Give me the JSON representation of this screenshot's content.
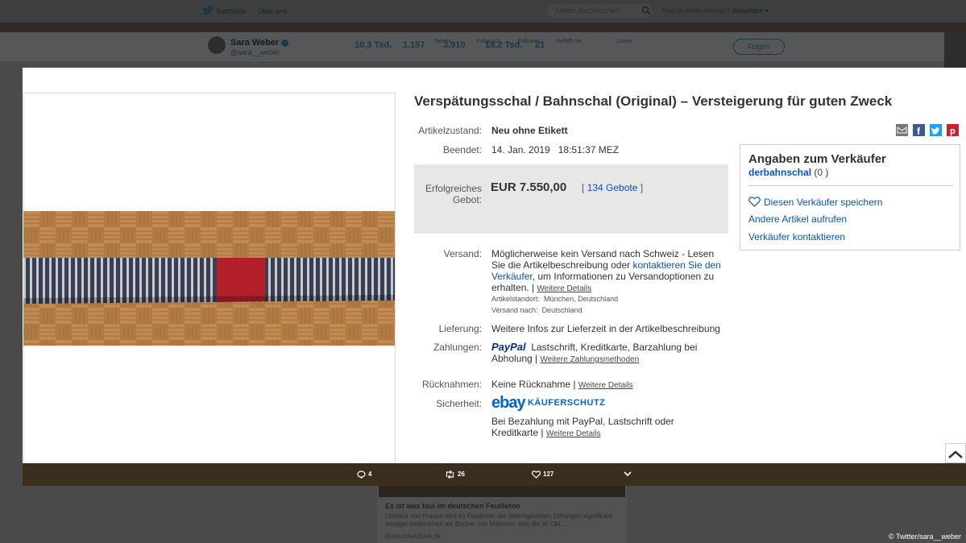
{
  "twitter": {
    "nav": {
      "home": "Startseite",
      "about": "Über uns",
      "search_placeholder": "Twitter durchsuchen",
      "account_prompt": "Hast du einen Account?",
      "login": "Anmelden"
    },
    "profile": {
      "name": "Sara Weber",
      "handle": "@sara__weber",
      "stats": [
        {
          "label": "Tweets",
          "value": "10,3 Tsd."
        },
        {
          "label": "Folge ich",
          "value": "1.157"
        },
        {
          "label": "Follower",
          "value": "3.910"
        },
        {
          "label": "Gefällt mir",
          "value": "18,2 Tsd."
        },
        {
          "label": "Listen",
          "value": "21"
        }
      ],
      "follow_button": "Folgen"
    },
    "actions": {
      "replies": "4",
      "retweets": "26",
      "likes": "127"
    },
    "card": {
      "title": "Es ist was faul im deutschen Feuilleton",
      "text": "Literatur von Frauen wird im Feuilleton der überregionalen Zeitungen signifikant weniger besprochen als Bücher von Männern. Wie die im Okt…",
      "source": "deutschlandfunk.de"
    }
  },
  "ebay": {
    "title": "Verspätungsschal / Bahnschal (Original) – Versteigerung für guten Zweck",
    "condition_label": "Artikelzustand:",
    "condition_value": "Neu ohne Etikett",
    "ended_label": "Beendet:",
    "ended_date": "14. Jan. 2019",
    "ended_time": "18:51:37 MEZ",
    "bid_label_1": "Erfolgreiches",
    "bid_label_2": "Gebot:",
    "bid_price": "EUR 7.550,00",
    "bid_count_prefix": "[",
    "bid_count": "134 Gebote",
    "bid_count_suffix": "]",
    "shipping_label": "Versand:",
    "shipping_line1": "Möglicherweise kein Versand nach Schweiz - Lesen",
    "shipping_line2a": "Sie die Artikelbeschreibung oder",
    "shipping_link_a": "kontaktieren Sie den",
    "shipping_link_b": "Verkäufer",
    "shipping_line3b": ", um Informationen zu Versandoptionen zu",
    "shipping_line4": "erhalten. |",
    "shipping_details": "Weitere Details",
    "location_label": "Artikelstandort:",
    "location_value": "München, Deutschland",
    "ship_to_label": "Versand nach:",
    "ship_to_value": "Deutschland",
    "delivery_label": "Lieferung:",
    "delivery_value": "Weitere Infos zur Lieferzeit in der Artikelbeschreibung",
    "payment_label": "Zahlungen:",
    "payment_logo": "PayPal",
    "payment_methods_1": "Lastschrift,  Kreditkarte,  Barzahlung bei",
    "payment_methods_2": "Abholung  |",
    "payment_more": "Weitere Zahlungsmethoden",
    "returns_label": "Rücknahmen:",
    "returns_value": "Keine Rücknahme |",
    "returns_details": "Weitere Details",
    "security_label": "Sicherheit:",
    "security_logo": "ebay",
    "security_brand": "KÄUFERSCHUTZ",
    "security_line1": "Bei Bezahlung mit PayPal, Lastschrift oder",
    "security_line2": "Kreditkarte |",
    "security_details": "Weitere Details",
    "seller": {
      "heading": "Angaben zum Verkäufer",
      "name": "derbahnschal",
      "rating": "0",
      "save": "Diesen Verkäufer speichern",
      "other_items": "Andere Artikel aufrufen",
      "contact": "Verkäufer kontaktieren"
    }
  },
  "credit": "© Twitter/sara__weber",
  "colors": {
    "link": "#0654ba",
    "paypal_dark": "#003087",
    "paypal_light": "#009cde",
    "ebay_red": "#e53238",
    "ebay_blue": "#0064d2",
    "ebay_yellow": "#f5af02",
    "ebay_green": "#86b817"
  }
}
